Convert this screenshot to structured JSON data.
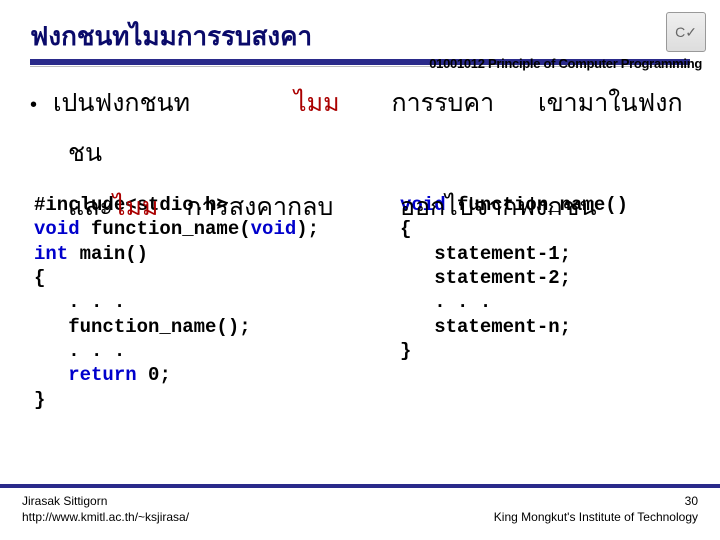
{
  "header": {
    "title": "ฟงกชนทไมมการรบสงคา",
    "course": "01001012 Principle of Computer Programming",
    "logo_text": "C✓"
  },
  "body": {
    "line1_a": "เปนฟงกชนท",
    "line1_red1": "ไมม",
    "line1_b": "การรบคา",
    "line1_c": "เขามาในฟงก",
    "line2": "ชน",
    "over_a": "และ",
    "over_red": "ไมม",
    "over_b": "การสงคากลบ",
    "over_right": "ออกไปจากฟงกชน"
  },
  "code_left": {
    "l1a": "#include<stdio.h>",
    "l2a": "void",
    "l2b": " function_name(",
    "l2c": "void",
    "l2d": ");",
    "l3a": "int",
    "l3b": " main()",
    "l4": "{",
    "l5": "   . . .",
    "l6": "   function_name();",
    "l7": "   . . .",
    "l8a": "   ",
    "l8b": "return",
    "l8c": " 0;",
    "l9": "}"
  },
  "code_right": {
    "l1a": "void",
    "l1b": " function_name()",
    "l2": "{",
    "l3": "   statement-1;",
    "l4": "   statement-2;",
    "l5": "   . . .",
    "l6": "   statement-n;",
    "l7": "}"
  },
  "footer": {
    "author": "Jirasak Sittigorn",
    "url": "http://www.kmitl.ac.th/~ksjirasa/",
    "page": "30",
    "institute": "King Mongkut's Institute of Technology"
  }
}
